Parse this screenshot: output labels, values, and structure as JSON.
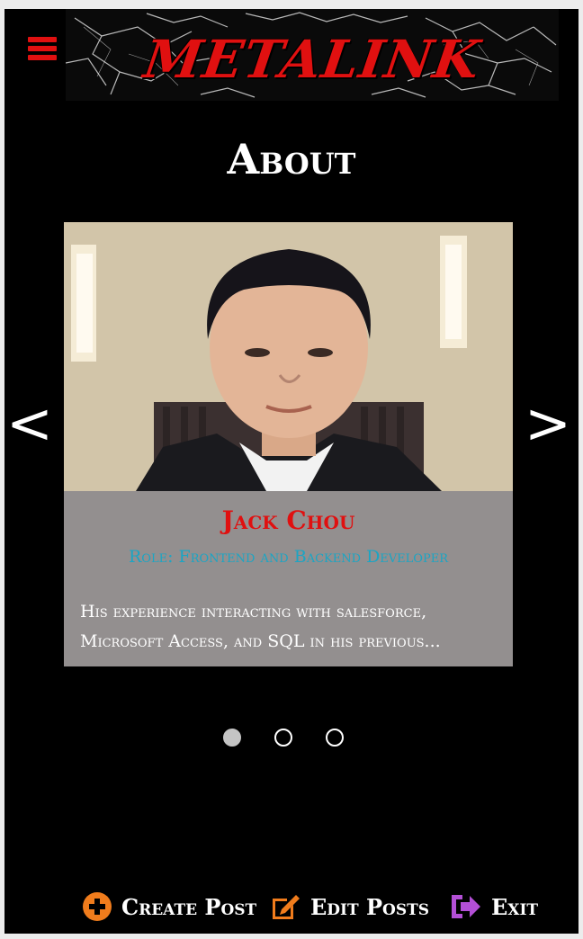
{
  "header": {
    "logo_text": "METALINK",
    "menu_icon": "hamburger-menu-icon",
    "accent_color": "#e01010"
  },
  "page": {
    "title": "About"
  },
  "carousel": {
    "current_index": 0,
    "total": 3,
    "prev_label": "<",
    "next_label": ">",
    "slide": {
      "name": "Jack Chou",
      "role": "Role: Frontend and Backend Developer",
      "bio": "His experience interacting with salesforce, Microsoft Access, and SQL in his previous..."
    }
  },
  "footer": {
    "actions": [
      {
        "label": "Create Post",
        "icon": "plus-circle-icon",
        "color": "#f07c1c"
      },
      {
        "label": "Edit Posts",
        "icon": "edit-icon",
        "color": "#f07c1c"
      },
      {
        "label": "Exit",
        "icon": "sign-out-icon",
        "color": "#b34fd6"
      }
    ]
  }
}
